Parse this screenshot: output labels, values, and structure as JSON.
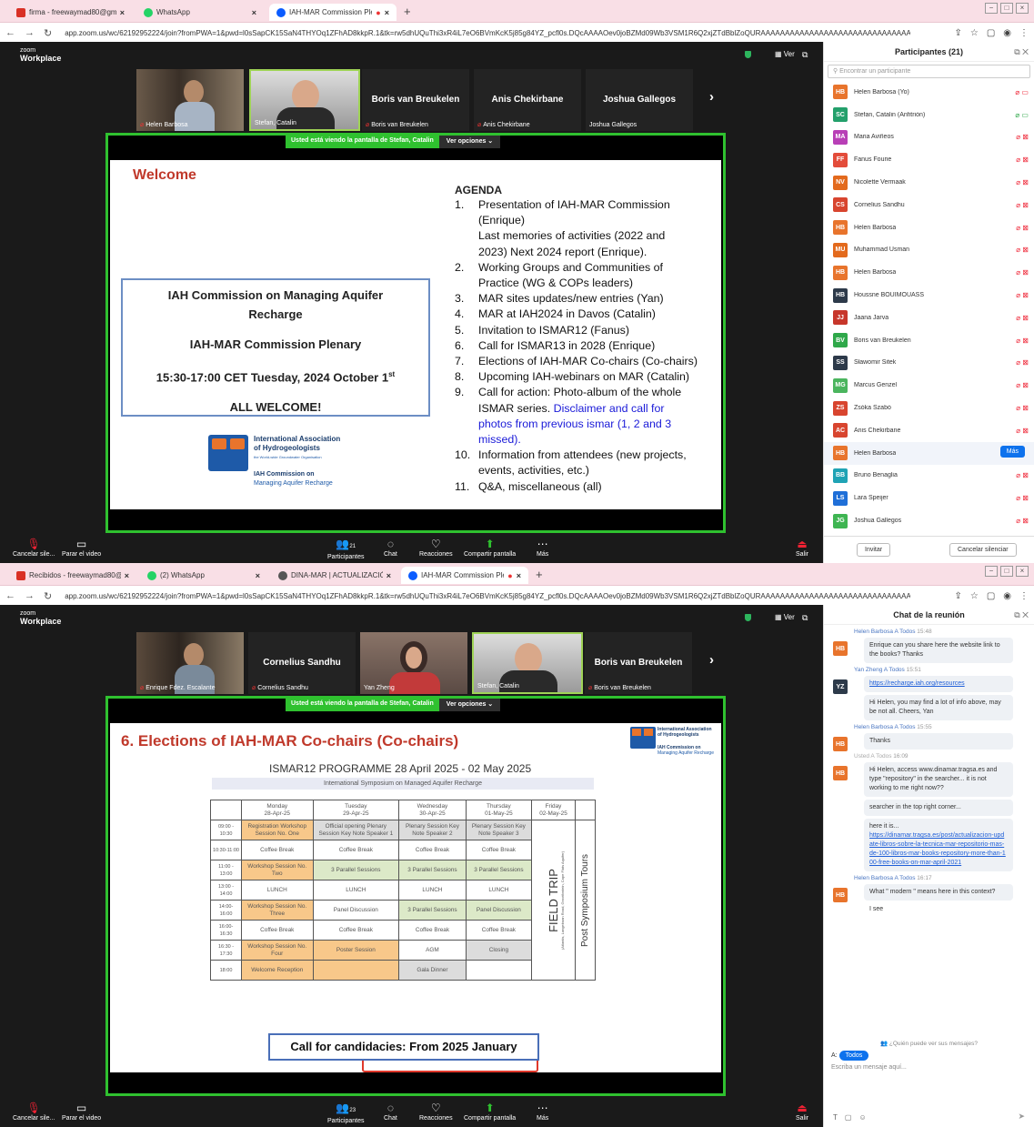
{
  "top": {
    "tabs": [
      {
        "label": "firma - freewaymad80@gmail.co",
        "icon": "gmail-icon"
      },
      {
        "label": "WhatsApp",
        "icon": "whatsapp-icon"
      },
      {
        "label": "IAH-MAR Commission Plena",
        "icon": "zoom-icon"
      }
    ],
    "url": "app.zoom.us/wc/62192952224/join?fromPWA=1&pwd=l0sSapCK15SaN4THYOq1ZFhAD8kkpR.1&tk=rw5dhUQuThi3xR4iL7eO6BVmKcK5j85g84YZ_pcfl0s.DQcAAAAOev0joBZMd09Wb3VSM1R6Q2xjZTdBblZoQURAAAAAAAAAAAAAAAAAAAAAAAAAAAAAAAAA...",
    "brand": {
      "line1": "zoom",
      "line2": "Workplace"
    },
    "ver": "Ver",
    "video_tiles": [
      {
        "name": "Helen Barbosa",
        "type": "photo"
      },
      {
        "name": "Stefan, Catalin",
        "type": "photo",
        "active": true
      },
      {
        "name": "Boris van Breukelen",
        "big": "Boris van Breukelen",
        "muted": true
      },
      {
        "name": "Anis Chekirbane",
        "big": "Anis Chekirbane",
        "muted": true
      },
      {
        "name": "Joshua Gallegos",
        "big": "Joshua Gallegos"
      }
    ],
    "share_label": "Usted está viendo la pantalla de",
    "share_name": "Stefan, Catalin",
    "share_options": "Ver opciones",
    "slide": {
      "welcome": "Welcome",
      "box_title1": "IAH Commission on Managing Aquifer",
      "box_title2": "Recharge",
      "box_title3": "IAH-MAR Commission Plenary",
      "box_time": "15:30-17:00 CET Tuesday, 2024 October 1",
      "box_time_sup": "st",
      "box_welcome": "ALL WELCOME!",
      "logo_line1": "International Association",
      "logo_line2": "of Hydrogeologists",
      "logo_line3": "the World-wide Groundwater Organisation",
      "logo_line4": "IAH Commission on",
      "logo_line5": "Managing Aquifer Recharge",
      "agenda_title": "AGENDA",
      "agenda": [
        {
          "n": "1.",
          "t": "Presentation of IAH-MAR Commission"
        },
        {
          "n": "",
          "t": "(Enrique)"
        },
        {
          "n": "",
          "t": "Last memories of activities (2022 and"
        },
        {
          "n": "",
          "t": "2023) Next 2024 report (Enrique)."
        },
        {
          "n": "2.",
          "t": "Working Groups and Communities of"
        },
        {
          "n": "",
          "t": "Practice (WG & COPs leaders)"
        },
        {
          "n": "3.",
          "t": "MAR sites updates/new entries (Yan)"
        },
        {
          "n": "4.",
          "t": "MAR at IAH2024 in Davos (Catalin)"
        },
        {
          "n": "5.",
          "t": "Invitation to ISMAR12 (Fanus)"
        },
        {
          "n": "6.",
          "t": "Call for ISMAR13 in 2028 (Enrique)"
        },
        {
          "n": "7.",
          "t": "Elections of IAH-MAR Co-chairs (Co-chairs)"
        },
        {
          "n": "8.",
          "t": "Upcoming IAH-webinars on MAR (Catalin)"
        },
        {
          "n": "9.",
          "t": "Call for action: Photo-album of the whole"
        },
        {
          "n": "",
          "t": "ISMAR series. ",
          "blue": "Disclaimer and call for"
        },
        {
          "n": "",
          "t": "",
          "blue": "photos from previous ismar (1, 2 and 3"
        },
        {
          "n": "",
          "t": "",
          "blue": "missed)."
        },
        {
          "n": "10.",
          "t": "Information from attendees (new projects,"
        },
        {
          "n": "",
          "t": "events, activities, etc.)"
        },
        {
          "n": "11.",
          "t": "Q&A, miscellaneous (all)"
        }
      ]
    },
    "bottom": {
      "mic": "Cancelar sile...",
      "video": "Parar el video",
      "participants": "Participantes",
      "participants_count": "21",
      "chat": "Chat",
      "reactions": "Reacciones",
      "share": "Compartir pantalla",
      "more": "Más",
      "leave": "Salir"
    },
    "panel": {
      "title": "Participantes (21)",
      "search_placeholder": "Encontrar un participante",
      "people": [
        {
          "ini": "HB",
          "name": "Helen Barbosa (Yo)",
          "color": "#e8742c"
        },
        {
          "ini": "SC",
          "name": "Stefan, Catalin (Anfitrión)",
          "color": "#23a06b"
        },
        {
          "ini": "MA",
          "name": "Maria Aviñeos",
          "color": "#b83fb6"
        },
        {
          "ini": "FF",
          "name": "Fanus Fourie",
          "color": "#e34c3a"
        },
        {
          "ini": "NV",
          "name": "Nicolette Vermaak",
          "color": "#e36a1d"
        },
        {
          "ini": "CS",
          "name": "Cornelius Sandhu",
          "color": "#d8452f"
        },
        {
          "ini": "HB",
          "name": "Helen Barbosa",
          "color": "#e8742c"
        },
        {
          "ini": "MU",
          "name": "Muhammad Usman",
          "color": "#e36a1d"
        },
        {
          "ini": "HB",
          "name": "Helen Barbosa",
          "color": "#e8742c"
        },
        {
          "ini": "HB",
          "name": "Houssne BOUIMOUASS",
          "color": "#2d3a4a"
        },
        {
          "ini": "JJ",
          "name": "Jaana Jarva",
          "color": "#c7362b"
        },
        {
          "ini": "BV",
          "name": "Boris van Breukelen",
          "color": "#2fa84a"
        },
        {
          "ini": "SS",
          "name": "Sławomir Sitek",
          "color": "#2d3a4a"
        },
        {
          "ini": "MG",
          "name": "Marcus Genzel",
          "color": "#4bb55e"
        },
        {
          "ini": "ZS",
          "name": "Zsóka Szabó",
          "color": "#d8452f"
        },
        {
          "ini": "AC",
          "name": "Anis Chekirbane",
          "color": "#d8452f"
        },
        {
          "ini": "HB",
          "name": "Helen Barbosa",
          "color": "#e8742c"
        },
        {
          "ini": "BB",
          "name": "Bruno Benaglia",
          "color": "#1fa3b5"
        },
        {
          "ini": "LS",
          "name": "Lara Speijer",
          "color": "#1f6fd8"
        },
        {
          "ini": "JG",
          "name": "Joshua Gallegos",
          "color": "#3fb552"
        }
      ],
      "more_btn": "Más",
      "invite": "Invitar",
      "mute_all": "Cancelar silenciar"
    }
  },
  "bottom": {
    "tabs": [
      {
        "label": "Recibidos - freewaymad80@gm",
        "icon": "gmail-icon"
      },
      {
        "label": "(2) WhatsApp",
        "icon": "whatsapp-icon"
      },
      {
        "label": "DINA-MAR | ACTUALIZACIÓN /",
        "icon": "web-icon"
      },
      {
        "label": "IAH-MAR Commission Plena",
        "icon": "zoom-icon"
      }
    ],
    "video_tiles": [
      {
        "name": "Enrique Fdez. Escalante",
        "type": "photo"
      },
      {
        "name": "Cornelius Sandhu",
        "big": "Cornelius Sandhu",
        "muted": true
      },
      {
        "name": "Yan Zheng",
        "type": "photo"
      },
      {
        "name": "Stefan, Catalin",
        "type": "photo",
        "active": true
      },
      {
        "name": "Boris van Breukelen",
        "big": "Boris van Breukelen",
        "muted": true
      }
    ],
    "slide": {
      "title": "6. Elections of IAH-MAR Co-chairs (Co-chairs)",
      "prog_title": "ISMAR12 PROGRAMME 28 April 2025 - 02 May 2025",
      "prog_sub": "International Symposium on Managed Aquifer Recharge",
      "days": [
        {
          "d": "Monday",
          "date": "28-Apr-25"
        },
        {
          "d": "Tuesday",
          "date": "29-Apr-25"
        },
        {
          "d": "Wednesday",
          "date": "30-Apr-25"
        },
        {
          "d": "Thursday",
          "date": "01-May-25"
        },
        {
          "d": "Friday",
          "date": "02-May-25"
        }
      ],
      "times": [
        "09:00 - 10:30",
        "10:30-11:00",
        "11:00 - 13:00",
        "13:00 - 14:00",
        "14:00-16:00",
        "16:00-16:30",
        "16:30 - 17:30",
        "18:00"
      ],
      "rows": [
        [
          "Registration Workshop Session No. One",
          "Official opening Plenary Session Key Note Speaker 1",
          "Plenary Session Key Note Speaker 2",
          "Plenary Session Key Note Speaker 3"
        ],
        [
          "Coffee Break",
          "Coffee Break",
          "Coffee Break",
          "Coffee Break"
        ],
        [
          "Workshop Session No. Two",
          "3 Parallel Sessions",
          "3 Parallel Sessions",
          "3 Parallel Sessions"
        ],
        [
          "LUNCH",
          "LUNCH",
          "LUNCH",
          "LUNCH"
        ],
        [
          "Workshop Session No. Three",
          "Panel Discussion",
          "3 Parallel Sessions",
          "Panel Discussion"
        ],
        [
          "Coffee Break",
          "Coffee Break",
          "Coffee Break",
          "Coffee Break"
        ],
        [
          "Workshop Session No. Four",
          "Poster Session",
          "AGM",
          "Closing"
        ],
        [
          "Welcome Reception",
          "",
          "Gala Dinner",
          ""
        ]
      ],
      "field_trip": "FIELD TRIP",
      "field_trip_sub": "(Atlantis, Langebaan Road, Grootfontein, Cape Flats Aquifer)",
      "post": "Post Symposium Tours",
      "logo_line1": "International Association",
      "logo_line2": "of Hydrogeologists",
      "logo_line4": "IAH Commission on",
      "logo_line5": "Managing Aquifer Recharge",
      "call": "Call for candidacies: From 2025 January"
    },
    "bottom_count": "23",
    "chat": {
      "title": "Chat de la reunión",
      "messages": [
        {
          "ini": "HB",
          "color": "#e8742c",
          "from": "Helen Barbosa",
          "to": "Todos",
          "time": "15:48",
          "text": "Enrique can you share here the website link to the books? Thanks"
        },
        {
          "ini": "YZ",
          "color": "#2d3a4a",
          "from": "Yan Zheng",
          "to": "Todos",
          "time": "15:51",
          "link": "https://recharge.iah.org/resources",
          "text": "Hi Helen, you may find a lot of info above, may be not all. Cheers, Yan"
        },
        {
          "ini": "HB",
          "color": "#e8742c",
          "from": "Helen Barbosa",
          "to": "Todos",
          "time": "15:55",
          "text": "Thanks"
        },
        {
          "ini": "HB",
          "color": "#e8742c",
          "from": "Usted",
          "to": "Todos",
          "time": "16:09",
          "text": "Hi Helen, access www.dinamar.tragsa.es and type \"repository\" in the searcher... it is not working to me right now??",
          "text2": "searcher in the top right corner...",
          "text3": "here it is...",
          "link": "https://dinamar.tragsa.es/post/actualizacion-update-libros-sobre-la-tecnica-mar-repositorio-mas-de-100-libros-mar-books-repository-more-than-100-free-books-on-mar-april-2021"
        },
        {
          "ini": "HB",
          "color": "#e8742c",
          "from": "Helen Barbosa",
          "to": "Todos",
          "time": "16:17",
          "text": "What \" modern \" means here in this context?",
          "text2": "I see"
        }
      ],
      "who": "¿Quién puede ver sus mensajes?",
      "to_label": "A:",
      "to_value": "Todos",
      "placeholder": "Escriba un mensaje aquí..."
    }
  }
}
